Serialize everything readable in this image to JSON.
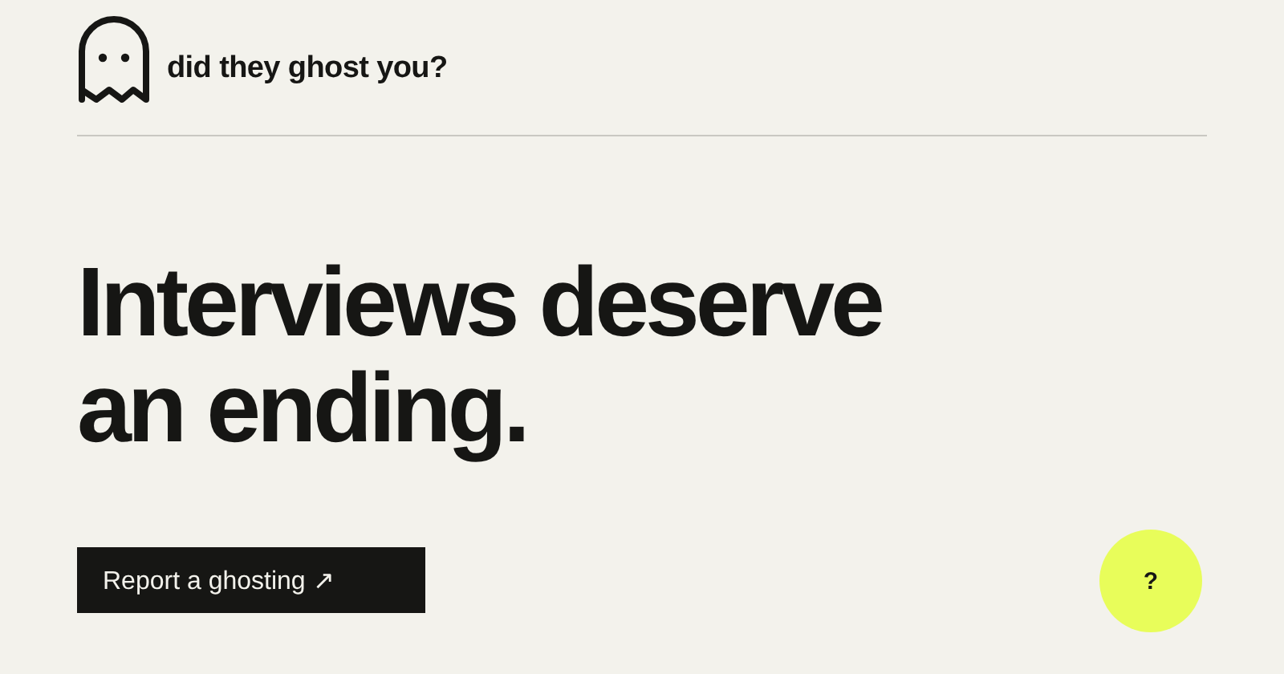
{
  "brand": {
    "name": "did they ghost you?"
  },
  "headline": [
    "Interviews deserve",
    "an ending."
  ],
  "cta": {
    "label": "Report a ghosting ↗"
  },
  "help": {
    "label": "?"
  }
}
